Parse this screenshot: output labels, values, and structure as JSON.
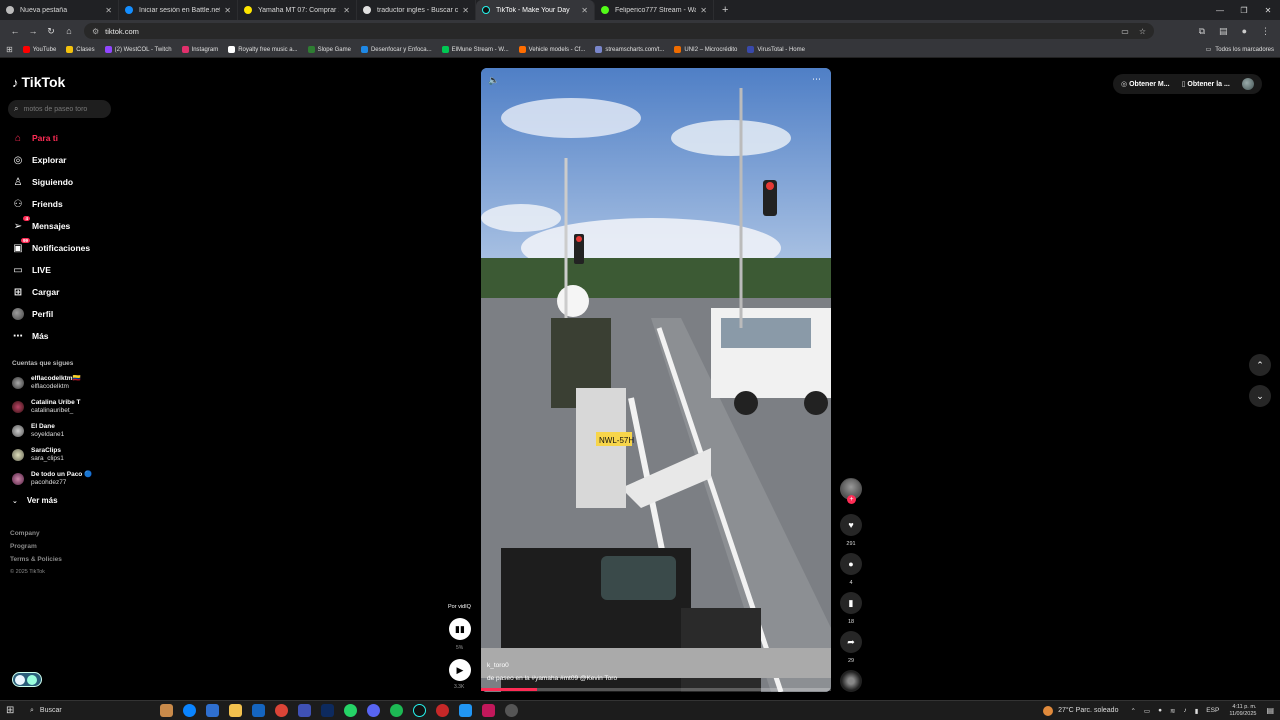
{
  "browser": {
    "tabs": [
      {
        "label": "Nueva pestaña",
        "active": false
      },
      {
        "label": "Iniciar sesión en Battle.net",
        "active": false
      },
      {
        "label": "Yamaha MT 07: Comprar 11 car",
        "active": false
      },
      {
        "label": "traductor ingles - Buscar con G",
        "active": false
      },
      {
        "label": "TikTok - Make Your Day",
        "active": true
      },
      {
        "label": "Felipe​rico777 Stream - Watch L",
        "active": false
      }
    ],
    "url": "tiktok.com",
    "bookmarks": [
      {
        "label": "YouTube",
        "color": "#ff0000"
      },
      {
        "label": "Clases",
        "color": "#f4c20d"
      },
      {
        "label": "(2) WestCOL - Twitch",
        "color": "#9146ff"
      },
      {
        "label": "Instagram",
        "color": "#e1306c"
      },
      {
        "label": "Royalty free music a...",
        "color": "#ffffff"
      },
      {
        "label": "Slope Game",
        "color": "#2e7d32"
      },
      {
        "label": "Desenfocar y Enfoca...",
        "color": "#1e88e5"
      },
      {
        "label": "ElMune Stream - W...",
        "color": "#00c853"
      },
      {
        "label": "Vehicle models - Cf...",
        "color": "#ff6d00"
      },
      {
        "label": "streamscharts.com/t...",
        "color": "#7986cb"
      },
      {
        "label": "UNI2 – Microcrédito",
        "color": "#ef6c00"
      },
      {
        "label": "VirusTotal - Home",
        "color": "#3949ab"
      }
    ],
    "all_bookmarks": "Todos los marcadores"
  },
  "sidebar": {
    "logo": "TikTok",
    "search_placeholder": "motos de paseo toro",
    "nav": [
      {
        "label": "Para ti",
        "icon": "home-icon",
        "active": true
      },
      {
        "label": "Explorar",
        "icon": "compass-icon"
      },
      {
        "label": "Siguiendo",
        "icon": "following-icon"
      },
      {
        "label": "Friends",
        "icon": "friends-icon"
      },
      {
        "label": "Mensajes",
        "icon": "messages-icon",
        "badge": "4"
      },
      {
        "label": "Notificaciones",
        "icon": "notifications-icon",
        "badge": "99"
      },
      {
        "label": "LIVE",
        "icon": "live-icon"
      },
      {
        "label": "Cargar",
        "icon": "upload-icon"
      },
      {
        "label": "Perfil",
        "icon": "profile-avatar"
      },
      {
        "label": "Más",
        "icon": "more-icon"
      }
    ],
    "following_title": "Cuentas que sigues",
    "accounts": [
      {
        "name": "elflacodelktm🇨🇴",
        "handle": "elflacodelktm"
      },
      {
        "name": "Catalina Uribe T",
        "handle": "catalinauribet_"
      },
      {
        "name": "El Dane",
        "handle": "soyeldane1"
      },
      {
        "name": "SaraClips",
        "handle": "sara_clips1"
      },
      {
        "name": "De todo un Paco 🔵",
        "handle": "pacohdez77"
      }
    ],
    "ver_mas": "Ver más",
    "footer_links": [
      "Company",
      "Program",
      "Terms & Policies"
    ],
    "copyright": "© 2025 TikTok"
  },
  "video": {
    "creator": "k_toro0",
    "caption": "de paseo en la #yamaha #mt09 @Kevin Toro",
    "plate": "NWL-57H",
    "progress_fraction": 0.16
  },
  "left_controls": {
    "vidiq_label": "Por vidIQ",
    "vidiq_pct": "5%",
    "play_count": "3.3K"
  },
  "actions": {
    "likes": "291",
    "comments": "4",
    "saves": "18",
    "shares": "29"
  },
  "top_right": {
    "btn1": "Obtener M...",
    "btn2": "Obtener la ..."
  },
  "taskbar": {
    "search": "Buscar",
    "weather": "27°C  Parc. soleado",
    "lang": "ESP",
    "time": "4:11 p. m.",
    "date": "11/09/2025"
  },
  "colors": {
    "accent": "#fe2c55",
    "background": "#000000"
  }
}
